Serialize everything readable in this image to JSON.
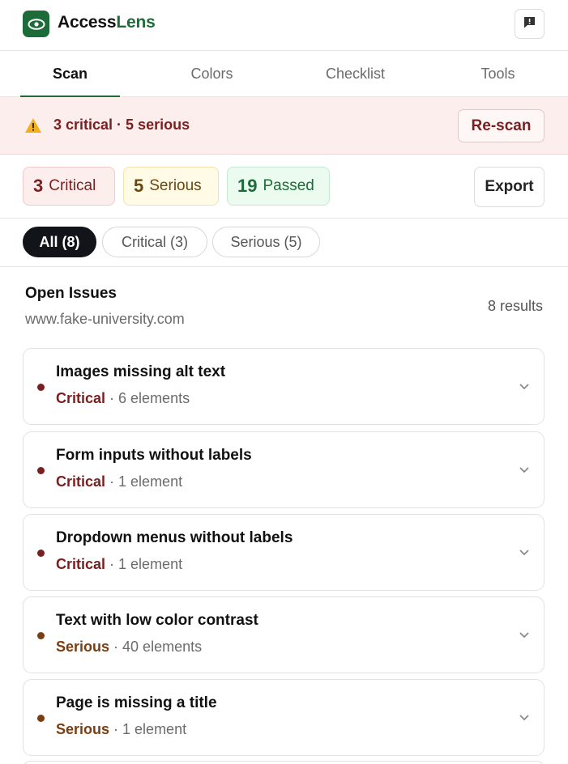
{
  "app": {
    "name_part1": "Access",
    "name_part2": "Lens",
    "logo_icon": "eye-icon",
    "feedback_icon": "feedback-icon"
  },
  "tabs": [
    {
      "label": "Scan",
      "active": true
    },
    {
      "label": "Colors",
      "active": false
    },
    {
      "label": "Checklist",
      "active": false
    },
    {
      "label": "Tools",
      "active": false
    }
  ],
  "alert": {
    "text": "3 critical · 5 serious",
    "icon": "warning-icon",
    "rescan_label": "Re-scan"
  },
  "summary": {
    "critical": {
      "count": "3",
      "label": "Critical"
    },
    "serious": {
      "count": "5",
      "label": "Serious"
    },
    "passed": {
      "count": "19",
      "label": "Passed"
    },
    "export_label": "Export"
  },
  "filters": [
    {
      "label": "All (8)",
      "active": true
    },
    {
      "label": "Critical (3)",
      "active": false
    },
    {
      "label": "Serious (5)",
      "active": false
    }
  ],
  "issues_header": {
    "title": "Open Issues",
    "url": "www.fake-university.com",
    "count": "8 results"
  },
  "issues": [
    {
      "title": "Images missing alt text",
      "severity": "Critical",
      "sep": " · ",
      "elements": "6 elements"
    },
    {
      "title": "Form inputs without labels",
      "severity": "Critical",
      "sep": " · ",
      "elements": "1 element"
    },
    {
      "title": "Dropdown menus without labels",
      "severity": "Critical",
      "sep": " · ",
      "elements": "1 element"
    },
    {
      "title": "Text with low color contrast",
      "severity": "Serious",
      "sep": " · ",
      "elements": "40 elements"
    },
    {
      "title": "Page is missing a title",
      "severity": "Serious",
      "sep": " · ",
      "elements": "1 element"
    }
  ],
  "colors": {
    "brand": "#1e6b3a",
    "critical": "#7a1f1f",
    "serious": "#7a3e10",
    "alert_bg": "#fdeeee"
  }
}
